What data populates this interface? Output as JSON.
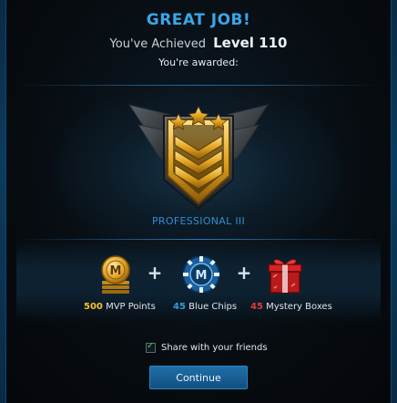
{
  "header": {
    "title": "GREAT JOB!",
    "achieved_prefix": "You've Achieved",
    "level": "Level 110",
    "awarded": "You're awarded:"
  },
  "rank": {
    "name": "PROFESSIONAL III",
    "icon": "rank-badge-icon"
  },
  "rewards": [
    {
      "amount": "500",
      "label": "MVP Points",
      "icon": "mvp-coin-icon",
      "color": "#f2c12e"
    },
    {
      "amount": "45",
      "label": "Blue Chips",
      "icon": "blue-chip-icon",
      "color": "#2f9be0"
    },
    {
      "amount": "45",
      "label": "Mystery Boxes",
      "icon": "mystery-box-icon",
      "color": "#e23a3a"
    }
  ],
  "share": {
    "label": "Share with your friends",
    "checked": true
  },
  "continue_label": "Continue",
  "colors": {
    "accent": "#3aa7e6",
    "gold": "#f2c12e",
    "blue": "#2f9be0",
    "red": "#e23a3a",
    "checkbox": "#3fd15a"
  }
}
